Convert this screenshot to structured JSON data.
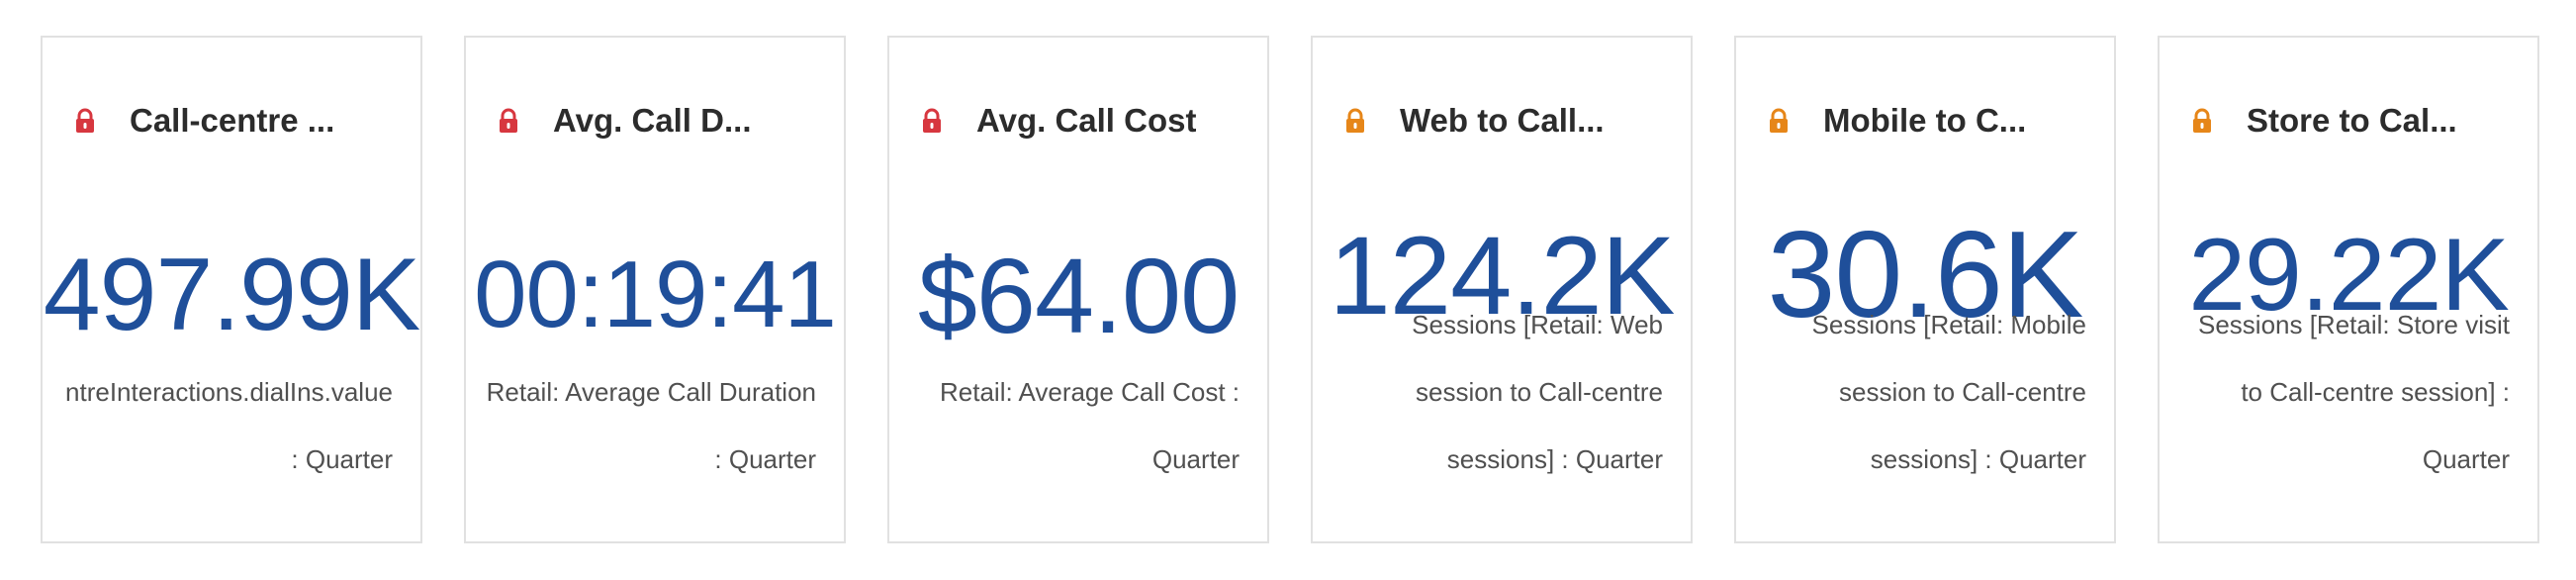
{
  "colors": {
    "value_blue": "#1f4f9a",
    "lock_red": "#d7373f",
    "lock_orange": "#e68619",
    "title": "#2c2c2c",
    "description": "#505050",
    "card_border": "#e1e1e1"
  },
  "cards": [
    {
      "title": "Call-centre ...",
      "value": "497.99K",
      "description_line1": "ntreInteractions.dialIns.value",
      "description_line2": ": Quarter",
      "lock_icon": "lock-icon",
      "lock_color": "#d7373f"
    },
    {
      "title": "Avg. Call D...",
      "value": "00:19:41",
      "description_line1": "Retail: Average Call Duration",
      "description_line2": ": Quarter",
      "lock_icon": "lock-icon",
      "lock_color": "#d7373f"
    },
    {
      "title": "Avg. Call Cost",
      "value": "$64.00",
      "description_line1": "Retail: Average Call Cost :",
      "description_line2": "Quarter",
      "lock_icon": "lock-icon",
      "lock_color": "#d7373f"
    },
    {
      "title": "Web to Call...",
      "value": "124.2K",
      "description_line1": "Sessions [Retail: Web",
      "description_line2": "session to Call-centre",
      "description_line3": "sessions] : Quarter",
      "lock_icon": "lock-icon",
      "lock_color": "#e68619"
    },
    {
      "title": "Mobile to C...",
      "value": "30.6K",
      "description_line1": "Sessions [Retail: Mobile",
      "description_line2": "session to Call-centre",
      "description_line3": "sessions] : Quarter",
      "lock_icon": "lock-icon",
      "lock_color": "#e68619"
    },
    {
      "title": "Store to Cal...",
      "value": "29.22K",
      "description_line1": "Sessions [Retail: Store visit",
      "description_line2": "to Call-centre session] :",
      "description_line3": "Quarter",
      "lock_icon": "lock-icon",
      "lock_color": "#e68619"
    }
  ]
}
